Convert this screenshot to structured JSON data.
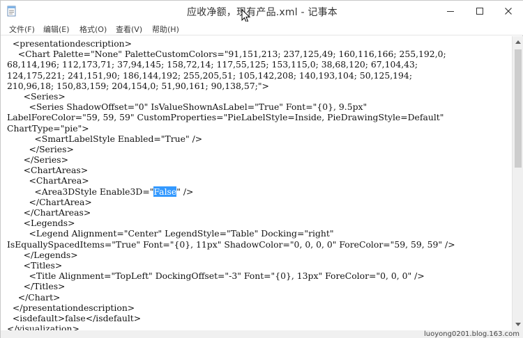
{
  "window": {
    "title": "应收净额，现有产品.xml - 记事本"
  },
  "menu": [
    {
      "label": "文件(F)"
    },
    {
      "label": "编辑(E)"
    },
    {
      "label": "格式(O)"
    },
    {
      "label": "查看(V)"
    },
    {
      "label": "帮助(H)"
    }
  ],
  "editor": {
    "lines": [
      "  <presentationdescription>",
      "    <Chart Palette=\"None\" PaletteCustomColors=\"91,151,213; 237,125,49; 160,116,166; 255,192,0;",
      "68,114,196; 112,173,71; 37,94,145; 158,72,14; 117,55,125; 153,115,0; 38,68,120; 67,104,43;",
      "124,175,221; 241,151,90; 186,144,192; 255,205,51; 105,142,208; 140,193,104; 50,125,194;",
      "210,96,18; 150,83,159; 204,154,0; 51,90,161; 90,138,57;\">",
      "      <Series>",
      "        <Series ShadowOffset=\"0\" IsValueShownAsLabel=\"True\" Font=\"{0}, 9.5px\"",
      "LabelForeColor=\"59, 59, 59\" CustomProperties=\"PieLabelStyle=Inside, PieDrawingStyle=Default\"",
      "ChartType=\"pie\">",
      "          <SmartLabelStyle Enabled=\"True\" />",
      "        </Series>",
      "      </Series>",
      "      <ChartAreas>",
      "        <ChartArea>",
      "          <Area3DStyle Enable3D=\"",
      "        </ChartArea>",
      "      </ChartAreas>",
      "      <Legends>",
      "        <Legend Alignment=\"Center\" LegendStyle=\"Table\" Docking=\"right\"",
      "IsEquallySpacedItems=\"True\" Font=\"{0}, 11px\" ShadowColor=\"0, 0, 0, 0\" ForeColor=\"59, 59, 59\" />",
      "      </Legends>",
      "      <Titles>",
      "        <Title Alignment=\"TopLeft\" DockingOffset=\"-3\" Font=\"{0}, 13px\" ForeColor=\"0, 0, 0\" />",
      "      </Titles>",
      "    </Chart>",
      "  </presentationdescription>",
      "  <isdefault>false</isdefault>",
      "</visualization>"
    ],
    "selected_text": "False",
    "after_selection": "\" />"
  },
  "status": {
    "watermark": "luoyong0201.blog.163.com"
  },
  "colors": {
    "selection": "#3399ff",
    "scrollbar": "#f0f0f0",
    "thumb": "#cdcdcd"
  }
}
